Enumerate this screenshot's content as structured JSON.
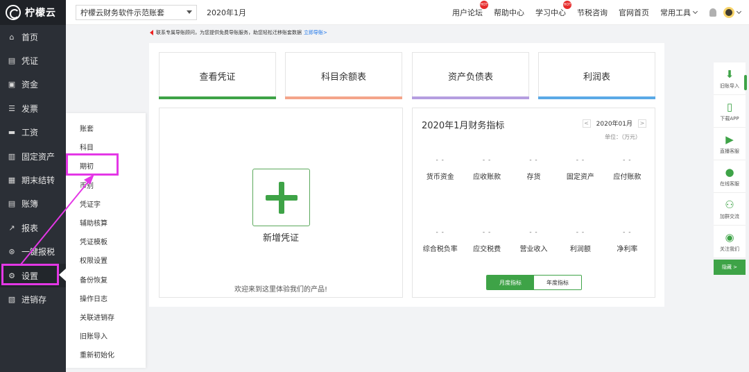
{
  "app": {
    "title": "柠檬云"
  },
  "sidebar": {
    "items": [
      {
        "label": "首页",
        "icon": "home-icon",
        "glyph": "⌂"
      },
      {
        "label": "凭证",
        "icon": "voucher-icon",
        "glyph": "▤"
      },
      {
        "label": "资金",
        "icon": "fund-icon",
        "glyph": "▣"
      },
      {
        "label": "发票",
        "icon": "invoice-icon",
        "glyph": "☰"
      },
      {
        "label": "工资",
        "icon": "salary-icon",
        "glyph": "▬"
      },
      {
        "label": "固定资产",
        "icon": "asset-icon",
        "glyph": "▥"
      },
      {
        "label": "期末结转",
        "icon": "period-close-icon",
        "glyph": "▦"
      },
      {
        "label": "账簿",
        "icon": "ledger-icon",
        "glyph": "▤"
      },
      {
        "label": "报表",
        "icon": "report-icon",
        "glyph": "↗"
      },
      {
        "label": "一键报税",
        "icon": "tax-icon",
        "glyph": "⊛"
      },
      {
        "label": "设置",
        "icon": "gear-icon",
        "glyph": "⚙"
      },
      {
        "label": "进销存",
        "icon": "inventory-icon",
        "glyph": "▧"
      }
    ],
    "active_index": 10
  },
  "topbar": {
    "account": "柠檬云财务软件示范账套",
    "period": "2020年1月",
    "links": [
      {
        "label": "用户论坛",
        "hot": true
      },
      {
        "label": "帮助中心",
        "hot": false
      },
      {
        "label": "学习中心",
        "hot": true
      },
      {
        "label": "节税咨询",
        "hot": false
      },
      {
        "label": "官网首页",
        "hot": false
      }
    ],
    "tools_label": "常用工具",
    "hot_badge": "HOT"
  },
  "notice": {
    "text": "联系专属导账顾问，为您提供免费导账服务，助您轻松迁移账套数据",
    "link": "立即导账>"
  },
  "quick_cards": [
    {
      "label": "查看凭证",
      "color": "#3ea347"
    },
    {
      "label": "科目余额表",
      "color": "#f4a58a"
    },
    {
      "label": "资产负债表",
      "color": "#b59ee0"
    },
    {
      "label": "利润表",
      "color": "#5aa9e6"
    }
  ],
  "voucher_panel": {
    "add_label": "新增凭证",
    "welcome": "欢迎来到这里体验我们的产品!"
  },
  "finance": {
    "title": "2020年1月财务指标",
    "date": "2020年01月",
    "prev": "<",
    "next": ">",
    "unit": "单位：（万元）",
    "row1": [
      {
        "label": "货币资金",
        "value": "- -"
      },
      {
        "label": "应收账款",
        "value": "- -"
      },
      {
        "label": "存货",
        "value": "- -"
      },
      {
        "label": "固定资产",
        "value": "- -"
      },
      {
        "label": "应付账款",
        "value": "- -"
      }
    ],
    "row2": [
      {
        "label": "综合税负率",
        "value": "- -"
      },
      {
        "label": "应交税费",
        "value": "- -"
      },
      {
        "label": "营业收入",
        "value": "- -"
      },
      {
        "label": "利润额",
        "value": "- -"
      },
      {
        "label": "净利率",
        "value": "- -"
      }
    ],
    "toggle": {
      "monthly": "月度指标",
      "yearly": "年度指标"
    }
  },
  "settings_menu": {
    "items": [
      "账套",
      "科目",
      "期初",
      "币别",
      "凭证字",
      "辅助核算",
      "凭证模板",
      "权限设置",
      "备份恢复",
      "操作日志",
      "关联进销存",
      "旧账导入",
      "重新初始化"
    ],
    "highlighted_index": 2,
    "highlight_color": "#e437e6"
  },
  "float_bar": {
    "items": [
      {
        "label": "旧账导入",
        "icon": "download-icon"
      },
      {
        "label": "下载APP",
        "icon": "phone-icon"
      },
      {
        "label": "直播客服",
        "icon": "video-icon"
      },
      {
        "label": "在线客服",
        "icon": "user-icon"
      },
      {
        "label": "加群交流",
        "icon": "group-icon"
      },
      {
        "label": "关注我们",
        "icon": "wechat-icon"
      }
    ],
    "hide_label": "隐藏 >"
  }
}
